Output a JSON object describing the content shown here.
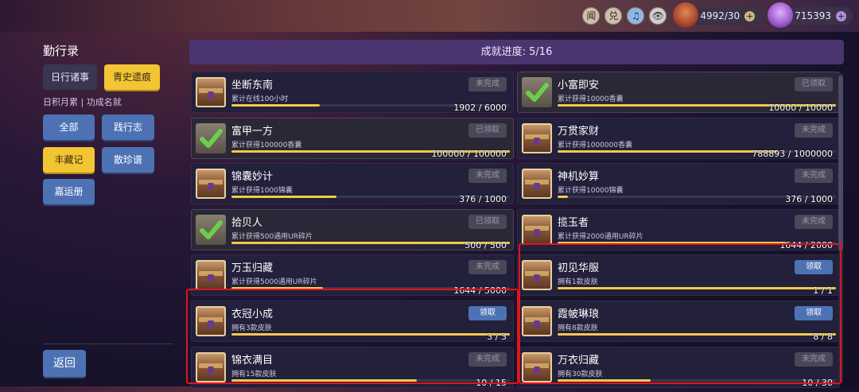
{
  "topbar": {
    "icons": [
      {
        "name": "news-icon",
        "glyph": "闻"
      },
      {
        "name": "exchange-icon",
        "glyph": "兑"
      },
      {
        "name": "music-icon",
        "glyph": "♫"
      },
      {
        "name": "eye-icon",
        "glyph": "👁"
      }
    ],
    "currency1": {
      "value": "4992/30",
      "plus": "+"
    },
    "currency2": {
      "value": "715393",
      "plus": "+"
    }
  },
  "left": {
    "title": "勤行录",
    "tabs": [
      "日行诸事",
      "青史遗痕"
    ],
    "subtitle": "日积月累 | 功成名就",
    "categories": [
      "全部",
      "践行志",
      "丰藏记",
      "散珍谱",
      "嘉运册"
    ],
    "back": "返回"
  },
  "progress": "成就进度: 5/16",
  "achievements_left": [
    {
      "name": "坐断东南",
      "desc": "累计在线100小时",
      "count": "1902 / 6000",
      "fill": 0.317,
      "status": "未完成",
      "state": "incomplete"
    },
    {
      "name": "富甲一方",
      "desc": "累计获得100000香囊",
      "count": "100000 / 100000",
      "fill": 1.0,
      "status": "已领取",
      "state": "claimed"
    },
    {
      "name": "锦囊妙计",
      "desc": "累计获得1000锦囊",
      "count": "376 / 1000",
      "fill": 0.376,
      "status": "未完成",
      "state": "incomplete"
    },
    {
      "name": "拾贝人",
      "desc": "累计获得500通用UR碎片",
      "count": "500 / 500",
      "fill": 1.0,
      "status": "已领取",
      "state": "claimed"
    },
    {
      "name": "万玉归藏",
      "desc": "累计获得5000通用UR碎片",
      "count": "1644 / 5000",
      "fill": 0.329,
      "status": "未完成",
      "state": "incomplete"
    },
    {
      "name": "衣冠小成",
      "desc": "拥有3款皮肤",
      "count": "3 / 3",
      "fill": 1.0,
      "status": "领取",
      "state": "claim"
    },
    {
      "name": "锦衣满目",
      "desc": "拥有15款皮肤",
      "count": "10 / 15",
      "fill": 0.667,
      "status": "未完成",
      "state": "incomplete"
    }
  ],
  "achievements_right": [
    {
      "name": "小富即安",
      "desc": "累计获得10000香囊",
      "count": "10000 / 10000",
      "fill": 1.0,
      "status": "已领取",
      "state": "claimed"
    },
    {
      "name": "万贯家财",
      "desc": "累计获得1000000香囊",
      "count": "788893 / 1000000",
      "fill": 0.789,
      "status": "未完成",
      "state": "incomplete"
    },
    {
      "name": "神机妙算",
      "desc": "累计获得10000锦囊",
      "count": "376 / 1000",
      "fill": 0.038,
      "status": "未完成",
      "state": "incomplete"
    },
    {
      "name": "揽玉者",
      "desc": "累计获得2000通用UR碎片",
      "count": "1644 / 2000",
      "fill": 0.822,
      "status": "未完成",
      "state": "incomplete"
    },
    {
      "name": "初见华服",
      "desc": "拥有1款皮肤",
      "count": "1 / 1",
      "fill": 1.0,
      "status": "领取",
      "state": "claim"
    },
    {
      "name": "霞帔琳琅",
      "desc": "拥有8款皮肤",
      "count": "8 / 8",
      "fill": 1.0,
      "status": "领取",
      "state": "claim"
    },
    {
      "name": "万衣归藏",
      "desc": "拥有30款皮肤",
      "count": "10 / 30",
      "fill": 0.333,
      "status": "未完成",
      "state": "incomplete"
    }
  ]
}
